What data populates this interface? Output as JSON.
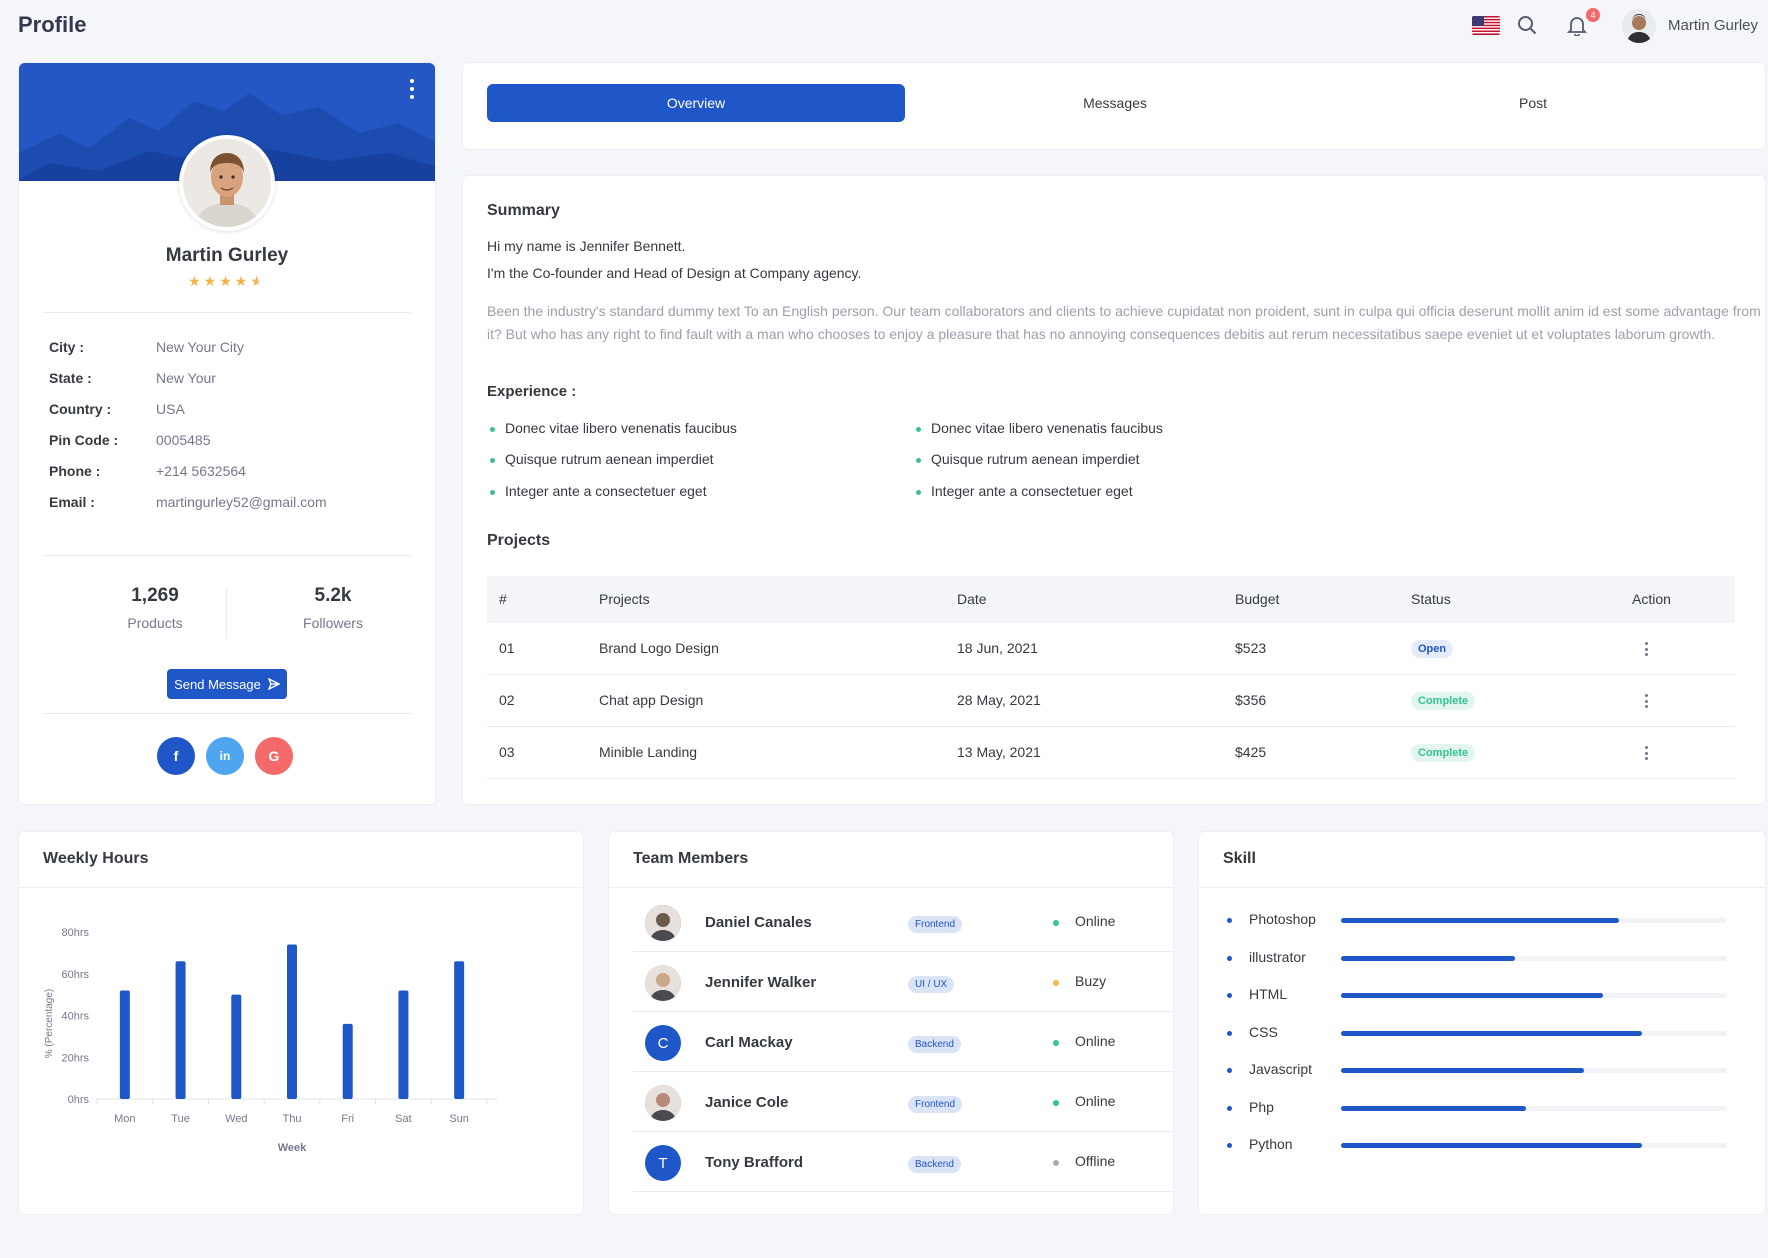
{
  "header": {
    "page_title": "Profile",
    "notification_count": "4",
    "user_name": "Martin Gurley"
  },
  "tabs": [
    {
      "label": "Overview",
      "active": true
    },
    {
      "label": "Messages",
      "active": false
    },
    {
      "label": "Post",
      "active": false
    }
  ],
  "profile": {
    "name": "Martin Gurley",
    "rating": 4.5,
    "info": [
      {
        "label": "City :",
        "value": "New Your City"
      },
      {
        "label": "State :",
        "value": "New Your"
      },
      {
        "label": "Country :",
        "value": "USA"
      },
      {
        "label": "Pin Code :",
        "value": "0005485"
      },
      {
        "label": "Phone :",
        "value": "+214 5632564"
      },
      {
        "label": "Email :",
        "value": "martingurley52@gmail.com"
      }
    ],
    "stats": [
      {
        "value": "1,269",
        "label": "Products"
      },
      {
        "value": "5.2k",
        "label": "Followers"
      }
    ],
    "send_message_label": "Send Message",
    "social": [
      {
        "name": "facebook",
        "glyph": "f",
        "color": "#1f56c8"
      },
      {
        "name": "linkedin",
        "glyph": "in",
        "color": "#50a5f1"
      },
      {
        "name": "google",
        "glyph": "G",
        "color": "#f46a6a"
      }
    ]
  },
  "summary": {
    "title": "Summary",
    "line1": "Hi my name is Jennifer Bennett.",
    "line2": "I'm the Co-founder and Head of Design at Company agency.",
    "paragraph": "Been the industry's standard dummy text To an English person. Our team collaborators and clients to achieve cupidatat non proident, sunt in culpa qui officia deserunt mollit anim id est some advantage from it? But who has any right to find fault with a man who chooses to enjoy a pleasure that has no annoying consequences debitis aut rerum necessitatibus saepe eveniet ut et voluptates laborum growth.",
    "experience_title": "Experience :",
    "experience_left": [
      "Donec vitae libero venenatis faucibus",
      "Quisque rutrum aenean imperdiet",
      "Integer ante a consectetuer eget"
    ],
    "experience_right": [
      "Donec vitae libero venenatis faucibus",
      "Quisque rutrum aenean imperdiet",
      "Integer ante a consectetuer eget"
    ]
  },
  "projects": {
    "title": "Projects",
    "columns": [
      "#",
      "Projects",
      "Date",
      "Budget",
      "Status",
      "Action"
    ],
    "rows": [
      {
        "id": "01",
        "name": "Brand Logo Design",
        "date": "18 Jun, 2021",
        "budget": "$523",
        "status": "Open"
      },
      {
        "id": "02",
        "name": "Chat app Design",
        "date": "28 May, 2021",
        "budget": "$356",
        "status": "Complete"
      },
      {
        "id": "03",
        "name": "Minible Landing",
        "date": "13 May, 2021",
        "budget": "$425",
        "status": "Complete"
      }
    ]
  },
  "weekly_hours": {
    "title": "Weekly Hours"
  },
  "chart_data": {
    "type": "bar",
    "categories": [
      "Mon",
      "Tue",
      "Wed",
      "Thu",
      "Fri",
      "Sat",
      "Sun"
    ],
    "values": [
      52,
      66,
      50,
      74,
      36,
      52,
      66
    ],
    "ylim": [
      0,
      80
    ],
    "yticks": [
      0,
      20,
      40,
      60,
      80
    ],
    "ytick_labels": [
      "0hrs",
      "20hrs",
      "40hrs",
      "60hrs",
      "80hrs"
    ],
    "xlabel": "Week",
    "ylabel": "% (Percentage)",
    "color": "#1f56c8"
  },
  "team": {
    "title": "Team Members",
    "members": [
      {
        "name": "Daniel Canales",
        "role": "Frontend",
        "status": "Online",
        "status_color": "#34c38f",
        "avatar": "photo",
        "avatar_color": "#6b5b4e"
      },
      {
        "name": "Jennifer Walker",
        "role": "UI / UX",
        "status": "Buzy",
        "status_color": "#f1b44c",
        "avatar": "photo",
        "avatar_color": "#c9a98a"
      },
      {
        "name": "Carl Mackay",
        "role": "Backend",
        "status": "Online",
        "status_color": "#34c38f",
        "avatar": "C",
        "avatar_color": "#1f56c8"
      },
      {
        "name": "Janice Cole",
        "role": "Frontend",
        "status": "Online",
        "status_color": "#34c38f",
        "avatar": "photo",
        "avatar_color": "#b98a7a"
      },
      {
        "name": "Tony Brafford",
        "role": "Backend",
        "status": "Offline",
        "status_color": "#a6abb5",
        "avatar": "T",
        "avatar_color": "#1f56c8"
      }
    ]
  },
  "skills": {
    "title": "Skill",
    "items": [
      {
        "name": "Photoshop",
        "level": 0.72
      },
      {
        "name": "illustrator",
        "level": 0.45
      },
      {
        "name": "HTML",
        "level": 0.68
      },
      {
        "name": "CSS",
        "level": 0.78
      },
      {
        "name": "Javascript",
        "level": 0.63
      },
      {
        "name": "Php",
        "level": 0.48
      },
      {
        "name": "Python",
        "level": 0.78
      }
    ]
  }
}
